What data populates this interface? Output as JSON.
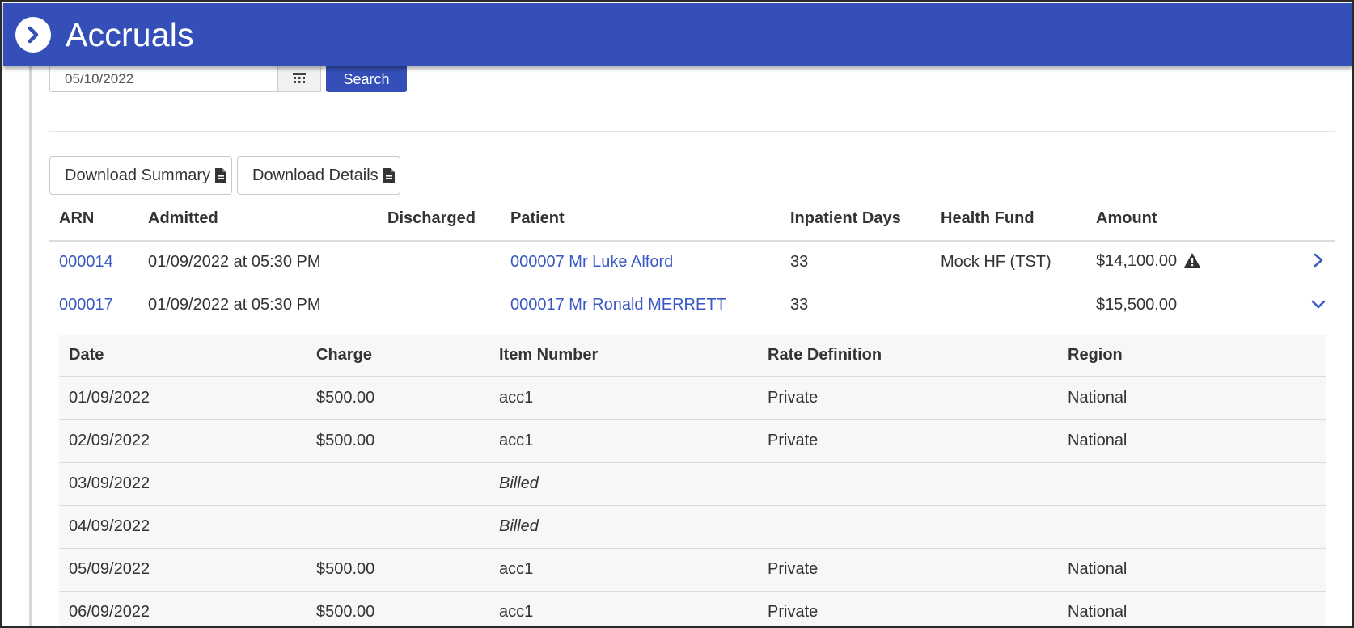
{
  "app": {
    "title": "Accruals",
    "brand_color": "#3450b8",
    "link_color": "#3a57c4"
  },
  "search": {
    "date_value": "05/10/2022",
    "search_label": "Search"
  },
  "downloads": {
    "summary_label": "Download Summary",
    "details_label": "Download Details"
  },
  "accruals_table": {
    "columns": [
      "ARN",
      "Admitted",
      "Discharged",
      "Patient",
      "Inpatient Days",
      "Health Fund",
      "Amount"
    ],
    "rows": [
      {
        "arn": "000014",
        "admitted": "01/09/2022 at 05:30 PM",
        "discharged": "",
        "patient": "000007 Mr Luke Alford",
        "inpatient_days": "33",
        "health_fund": "Mock HF (TST)",
        "amount": "$14,100.00",
        "has_warning": true,
        "expanded": false
      },
      {
        "arn": "000017",
        "admitted": "01/09/2022 at 05:30 PM",
        "discharged": "",
        "patient": "000017 Mr Ronald MERRETT",
        "inpatient_days": "33",
        "health_fund": "",
        "amount": "$15,500.00",
        "has_warning": false,
        "expanded": true
      }
    ]
  },
  "details_table": {
    "columns": [
      "Date",
      "Charge",
      "Item Number",
      "Rate Definition",
      "Region"
    ],
    "rows": [
      {
        "date": "01/09/2022",
        "charge": "$500.00",
        "item": "acc1",
        "rate": "Private",
        "region": "National"
      },
      {
        "date": "02/09/2022",
        "charge": "$500.00",
        "item": "acc1",
        "rate": "Private",
        "region": "National"
      },
      {
        "date": "03/09/2022",
        "charge": "",
        "item": "Billed",
        "rate": "",
        "region": ""
      },
      {
        "date": "04/09/2022",
        "charge": "",
        "item": "Billed",
        "rate": "",
        "region": ""
      },
      {
        "date": "05/09/2022",
        "charge": "$500.00",
        "item": "acc1",
        "rate": "Private",
        "region": "National"
      },
      {
        "date": "06/09/2022",
        "charge": "$500.00",
        "item": "acc1",
        "rate": "Private",
        "region": "National"
      }
    ]
  },
  "icons": {
    "back": "chevron-right-circle-icon",
    "calendar": "calendar-icon",
    "file": "file-document-icon",
    "warning": "warning-triangle-icon",
    "expand": "chevron-right-icon",
    "collapse": "chevron-down-icon"
  }
}
